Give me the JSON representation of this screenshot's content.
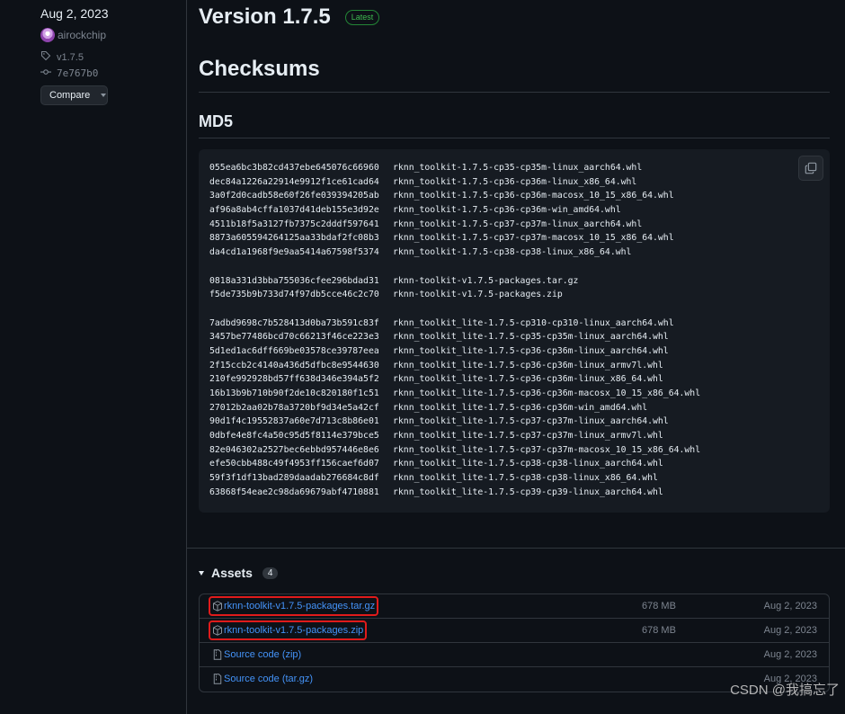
{
  "sidebar": {
    "date": "Aug 2, 2023",
    "author": "airockchip",
    "tag": "v1.7.5",
    "commit": "7e767b0",
    "compare_label": "Compare"
  },
  "release": {
    "title": "Version 1.7.5",
    "badge": "Latest"
  },
  "checksums": {
    "heading": "Checksums",
    "subheading": "MD5",
    "groups": [
      [
        {
          "hash": "055ea6bc3b82cd437ebe645076c66960",
          "file": "rknn_toolkit-1.7.5-cp35-cp35m-linux_aarch64.whl"
        },
        {
          "hash": "dec84a1226a22914e9912f1ce61cad64",
          "file": "rknn_toolkit-1.7.5-cp36-cp36m-linux_x86_64.whl"
        },
        {
          "hash": "3a0f2d0cadb58e60f26fe039394205ab",
          "file": "rknn_toolkit-1.7.5-cp36-cp36m-macosx_10_15_x86_64.whl"
        },
        {
          "hash": "af96a8ab4cffa1037d41deb155e3d92e",
          "file": "rknn_toolkit-1.7.5-cp36-cp36m-win_amd64.whl"
        },
        {
          "hash": "4511b18f5a3127fb7375c2dddf597641",
          "file": "rknn_toolkit-1.7.5-cp37-cp37m-linux_aarch64.whl"
        },
        {
          "hash": "8873a605594264125aa33bdaf2fc08b3",
          "file": "rknn_toolkit-1.7.5-cp37-cp37m-macosx_10_15_x86_64.whl"
        },
        {
          "hash": "da4cd1a1968f9e9aa5414a67598f5374",
          "file": "rknn_toolkit-1.7.5-cp38-cp38-linux_x86_64.whl"
        }
      ],
      [
        {
          "hash": "0818a331d3bba755036cfee296bdad31",
          "file": "rknn-toolkit-v1.7.5-packages.tar.gz"
        },
        {
          "hash": "f5de735b9b733d74f97db5cce46c2c70",
          "file": "rknn-toolkit-v1.7.5-packages.zip"
        }
      ],
      [
        {
          "hash": "7adbd9698c7b528413d0ba73b591c83f",
          "file": "rknn_toolkit_lite-1.7.5-cp310-cp310-linux_aarch64.whl"
        },
        {
          "hash": "3457be77486bcd70c66213f46ce223e3",
          "file": "rknn_toolkit_lite-1.7.5-cp35-cp35m-linux_aarch64.whl"
        },
        {
          "hash": "5d1ed1ac6dff669be03578ce39787eea",
          "file": "rknn_toolkit_lite-1.7.5-cp36-cp36m-linux_aarch64.whl"
        },
        {
          "hash": "2f15ccb2c4140a436d5dfbc8e9544630",
          "file": "rknn_toolkit_lite-1.7.5-cp36-cp36m-linux_armv7l.whl"
        },
        {
          "hash": "210fe992928bd57ff638d346e394a5f2",
          "file": "rknn_toolkit_lite-1.7.5-cp36-cp36m-linux_x86_64.whl"
        },
        {
          "hash": "16b13b9b710b90f2de10c820180f1c51",
          "file": "rknn_toolkit_lite-1.7.5-cp36-cp36m-macosx_10_15_x86_64.whl"
        },
        {
          "hash": "27012b2aa02b78a3720bf9d34e5a42cf",
          "file": "rknn_toolkit_lite-1.7.5-cp36-cp36m-win_amd64.whl"
        },
        {
          "hash": "90d1f4c19552837a60e7d713c8b86e01",
          "file": "rknn_toolkit_lite-1.7.5-cp37-cp37m-linux_aarch64.whl"
        },
        {
          "hash": "0dbfe4e8fc4a50c95d5f8114e379bce5",
          "file": "rknn_toolkit_lite-1.7.5-cp37-cp37m-linux_armv7l.whl"
        },
        {
          "hash": "82e046302a2527bec6ebbd957446e8e6",
          "file": "rknn_toolkit_lite-1.7.5-cp37-cp37m-macosx_10_15_x86_64.whl"
        },
        {
          "hash": "efe50cbb488c49f4953ff156caef6d07",
          "file": "rknn_toolkit_lite-1.7.5-cp38-cp38-linux_aarch64.whl"
        },
        {
          "hash": "59f3f1df13bad289daadab276684c8df",
          "file": "rknn_toolkit_lite-1.7.5-cp38-cp38-linux_x86_64.whl"
        },
        {
          "hash": "63868f54eae2c98da69679abf4710881",
          "file": "rknn_toolkit_lite-1.7.5-cp39-cp39-linux_aarch64.whl"
        }
      ]
    ]
  },
  "assets": {
    "heading": "Assets",
    "count": "4",
    "items": [
      {
        "name": "rknn-toolkit-v1.7.5-packages.tar.gz",
        "size": "678 MB",
        "date": "Aug 2, 2023",
        "icon": "package-icon",
        "highlighted": true
      },
      {
        "name": "rknn-toolkit-v1.7.5-packages.zip",
        "size": "678 MB",
        "date": "Aug 2, 2023",
        "icon": "package-icon",
        "highlighted": true
      },
      {
        "name": "Source code (zip)",
        "size": "",
        "date": "Aug 2, 2023",
        "icon": "file-zip-icon",
        "highlighted": false
      },
      {
        "name": "Source code (tar.gz)",
        "size": "",
        "date": "Aug 2, 2023",
        "icon": "file-zip-icon",
        "highlighted": false
      }
    ]
  },
  "watermark": "CSDN @我搞忘了",
  "colors": {
    "background": "#0d1117",
    "link": "#4493f8",
    "latest_badge": "#3fb950",
    "highlight_box": "#e01b1b"
  }
}
